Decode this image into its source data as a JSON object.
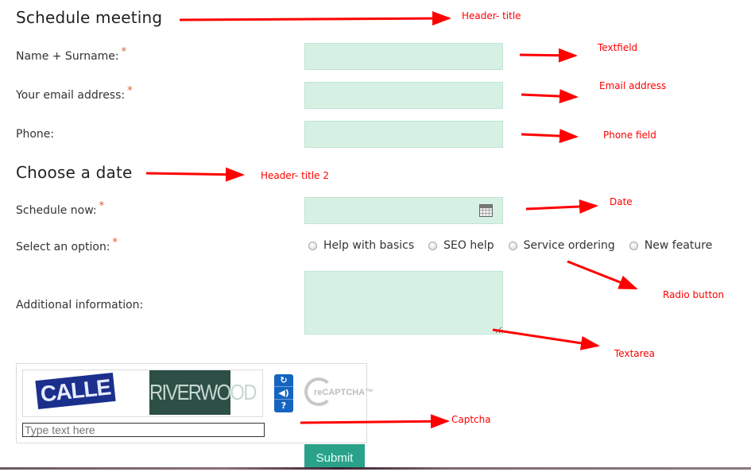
{
  "form": {
    "title": "Schedule meeting",
    "fields": {
      "name": {
        "label": "Name + Surname:",
        "required": "*",
        "value": ""
      },
      "email": {
        "label": "Your email address:",
        "required": "*",
        "value": ""
      },
      "phone": {
        "label": "Phone:",
        "value": ""
      }
    },
    "section2_title": "Choose a date",
    "schedule": {
      "label": "Schedule now:",
      "required": "*",
      "value": "",
      "icon": "calendar-icon"
    },
    "option": {
      "label": "Select an option:",
      "required": "*",
      "choices": [
        "Help with basics",
        "SEO help",
        "Service ordering",
        "New feature"
      ],
      "selected": null
    },
    "additional": {
      "label": "Additional information:",
      "value": ""
    },
    "captcha": {
      "word1": "CALLE",
      "word2": "RIVERWOOD",
      "buttons": {
        "refresh": "↻",
        "audio": "◀)",
        "help": "?"
      },
      "logo_text": "reCAPTCHA™",
      "input_placeholder": "Type text here"
    },
    "submit_label": "Submit"
  },
  "annotations": {
    "header_title": "Header- title",
    "textfield": "Textfield",
    "email_address": "Email address",
    "phone_field": "Phone field",
    "header_title_2": "Header- title 2",
    "date": "Date",
    "radio_button": "Radio button",
    "textarea": "Textarea",
    "captcha": "Captcha"
  },
  "colors": {
    "field_bg": "#d7f0e4",
    "required": "#e8562a",
    "submit_bg": "#2aa28a",
    "annotation": "#ff0000",
    "captcha_buttons": "#1565c0"
  }
}
